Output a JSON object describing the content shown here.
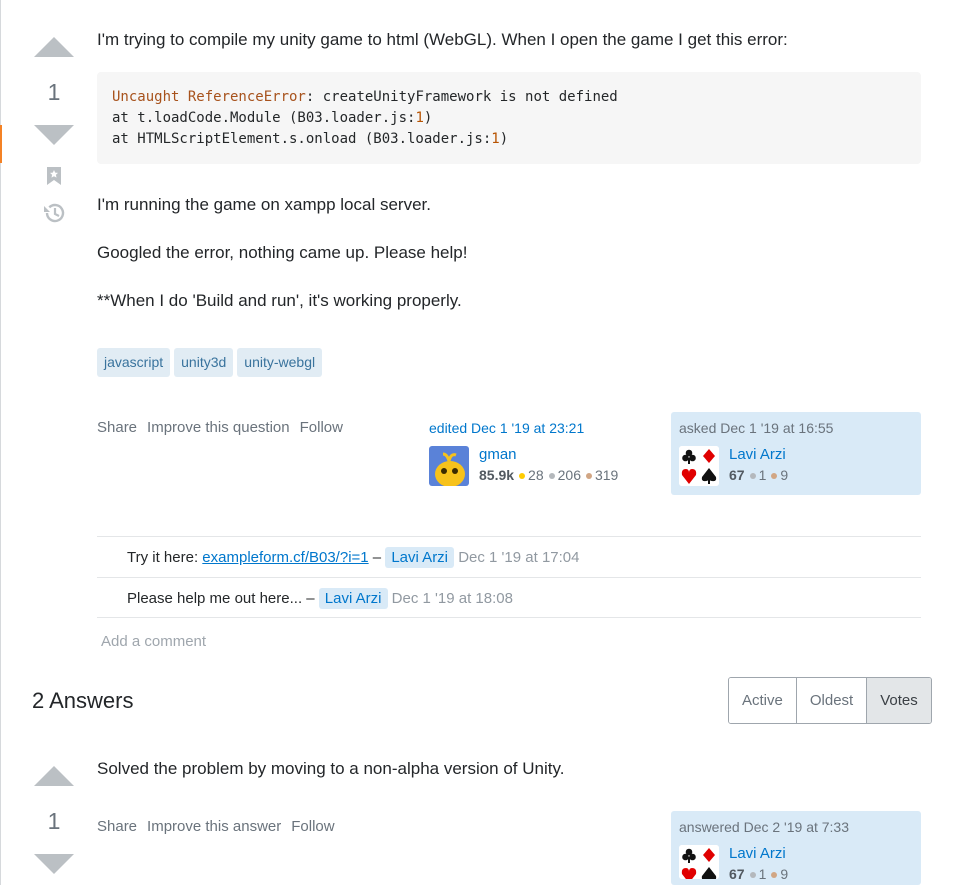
{
  "question": {
    "vote_count": "1",
    "intro": "I'm trying to compile my unity game to html (WebGL). When I open the game I get this error:",
    "code": {
      "line1_keyword": "Uncaught ReferenceError",
      "line1_rest": ": createUnityFramework is not defined",
      "line2_prefix": "at t.loadCode.Module (B03.loader.js:",
      "line2_num": "1",
      "line2_suffix": ")",
      "line3_prefix": "at HTMLScriptElement.s.onload (B03.loader.js:",
      "line3_num": "1",
      "line3_suffix": ")"
    },
    "paragraph1": "I'm running the game on xampp local server.",
    "paragraph2": "Googled the error, nothing came up. Please help!",
    "paragraph3": "**When I do 'Build and run', it's working properly.",
    "tags": [
      "javascript",
      "unity3d",
      "unity-webgl"
    ],
    "menu": {
      "share": "Share",
      "improve": "Improve this question",
      "follow": "Follow"
    },
    "editor": {
      "action": "edited Dec 1 '19 at 23:21",
      "name": "gman",
      "reputation": "85.9k",
      "gold": "28",
      "silver": "206",
      "bronze": "319"
    },
    "owner": {
      "action": "asked Dec 1 '19 at 16:55",
      "name": "Lavi Arzi",
      "reputation": "67",
      "silver": "1",
      "bronze": "9"
    }
  },
  "comments": [
    {
      "text": "Try it here: ",
      "link": "exampleform.cf/B03/?i=1",
      "separator": " – ",
      "user": "Lavi Arzi",
      "date": "Dec 1 '19 at 17:04"
    },
    {
      "text": "Please help me out here... ",
      "separator": "– ",
      "user": "Lavi Arzi",
      "date": "Dec 1 '19 at 18:08"
    }
  ],
  "add_comment": "Add a comment",
  "answers": {
    "count_label": "2 Answers",
    "sort_options": [
      "Active",
      "Oldest",
      "Votes"
    ],
    "selected_sort": "Votes",
    "items": [
      {
        "vote_count": "1",
        "text": "Solved the problem by moving to a non-alpha version of Unity.",
        "menu": {
          "share": "Share",
          "improve": "Improve this answer",
          "follow": "Follow"
        },
        "owner": {
          "action": "answered Dec 2 '19 at 7:33",
          "name": "Lavi Arzi",
          "reputation": "67",
          "silver": "1",
          "bronze": "9"
        }
      }
    ]
  },
  "colors": {
    "accent_blue": "#0077cc",
    "tag_bg": "#e1ecf4",
    "owner_card_bg": "#d9eaf7",
    "gold": "#ffcc01",
    "silver": "#b4b8bc",
    "bronze": "#d1a684"
  }
}
